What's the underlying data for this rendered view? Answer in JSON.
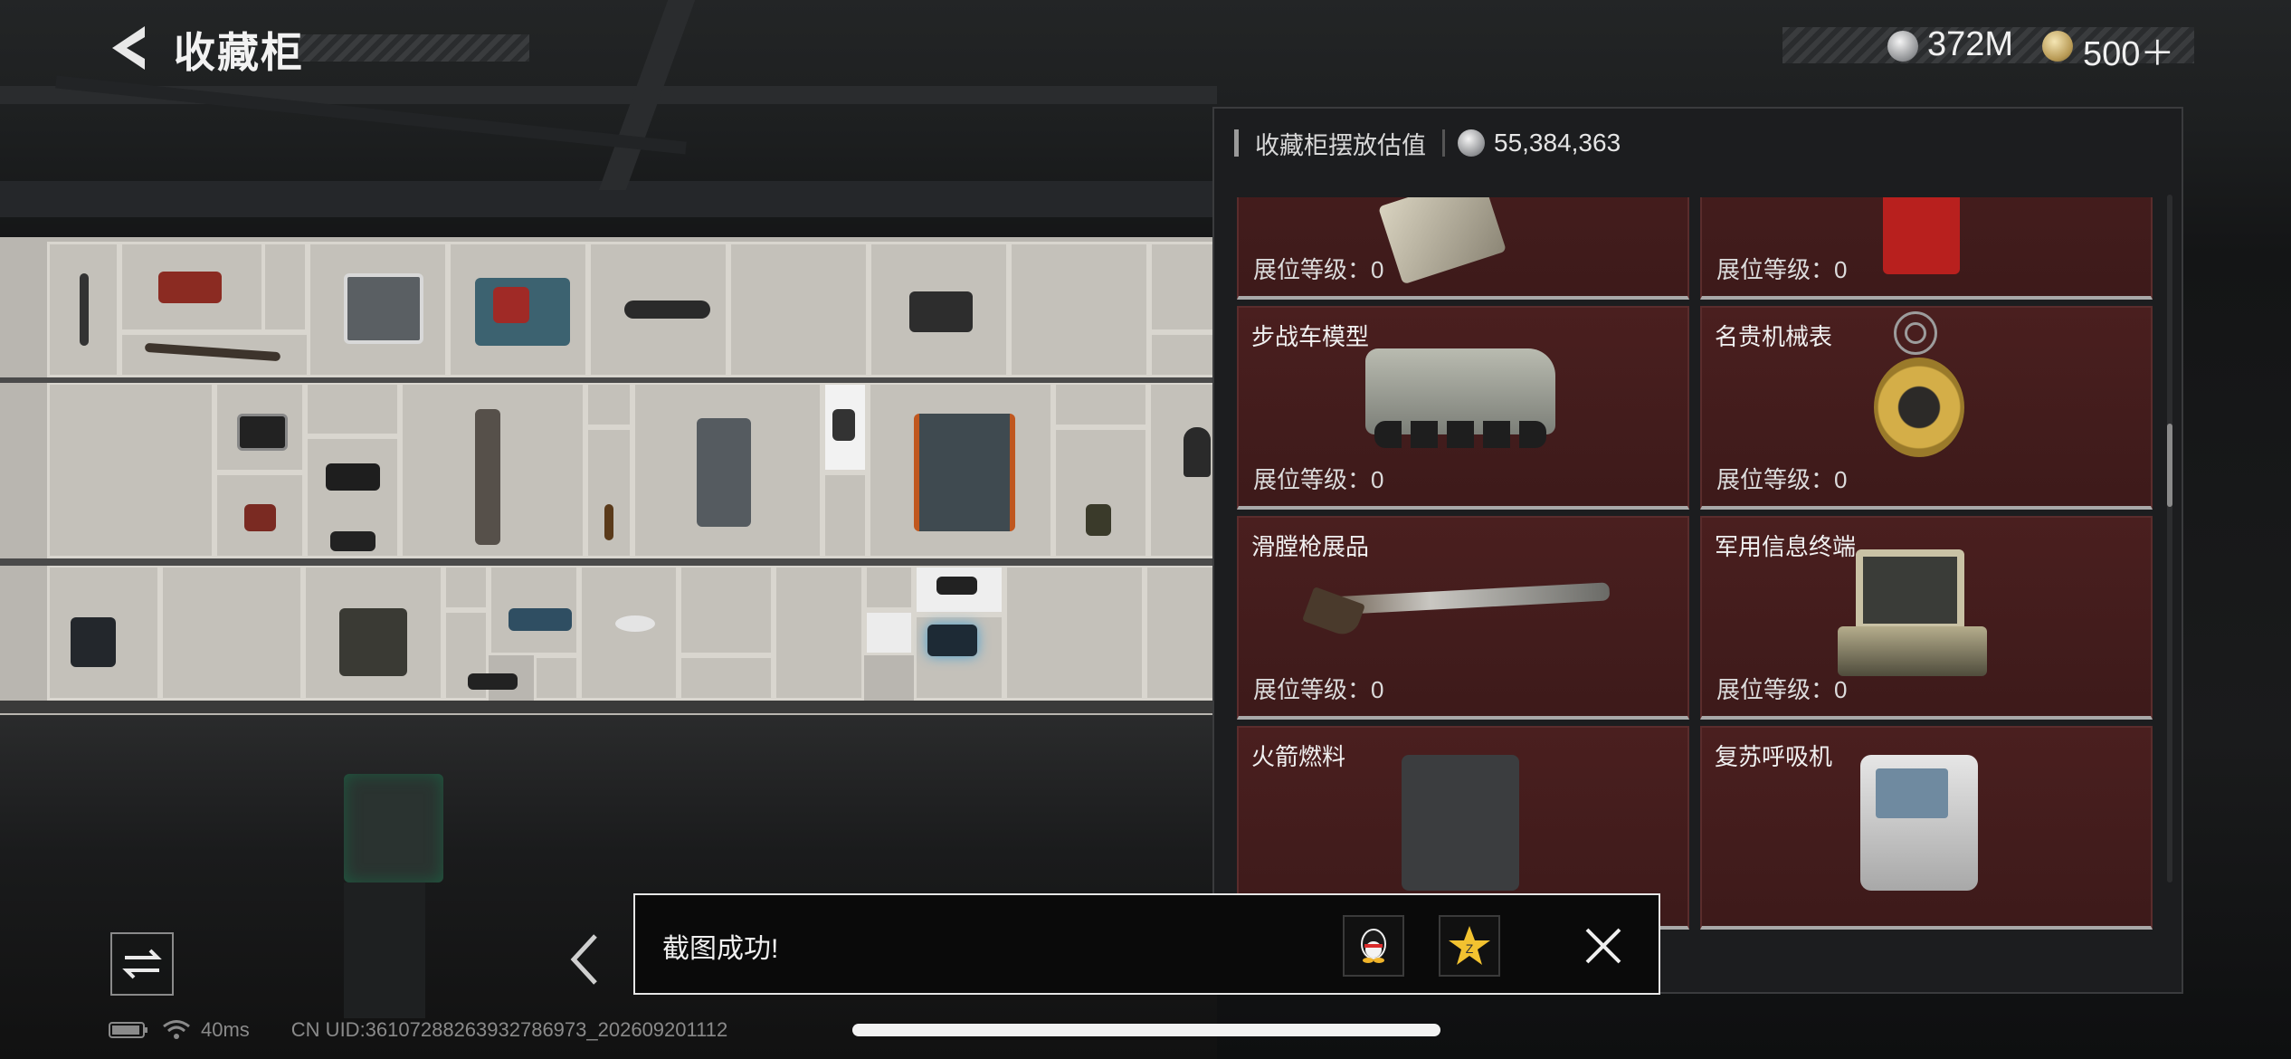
{
  "header": {
    "title": "收藏柜",
    "currency": [
      {
        "icon": "silver-coin-icon",
        "value": "372M"
      },
      {
        "icon": "gold-coin-icon",
        "value": "500＋"
      }
    ]
  },
  "panel": {
    "label": "收藏柜摆放估值",
    "value": "55,384,363",
    "items": [
      {
        "name": "",
        "level": "展位等级：0",
        "art": "graphics-card-icon"
      },
      {
        "name": "",
        "level": "展位等级：0",
        "art": "red-device-icon"
      },
      {
        "name": "步战车模型",
        "level": "展位等级：0",
        "art": "armored-vehicle-icon"
      },
      {
        "name": "名贵机械表",
        "level": "展位等级：0",
        "art": "gold-watch-icon"
      },
      {
        "name": "滑膛枪展品",
        "level": "展位等级：0",
        "art": "musket-icon"
      },
      {
        "name": "军用信息终端",
        "level": "展位等级：0",
        "art": "field-terminal-icon"
      },
      {
        "name": "火箭燃料",
        "level": "",
        "art": "fuel-canister-icon"
      },
      {
        "name": "复苏呼吸机",
        "level": "",
        "art": "respirator-icon"
      }
    ]
  },
  "toast": {
    "text": "截图成功!",
    "buttons": [
      "qq-share-icon",
      "qzone-share-icon",
      "close-icon"
    ]
  },
  "status": {
    "ping": "40ms",
    "uid": "CN UID:361072882639327869​73_202609201112"
  },
  "colors": {
    "card_bg": "#4a1f1f",
    "panel_bg": "#1c1d1f",
    "toast_border": "#e6e6e6"
  }
}
